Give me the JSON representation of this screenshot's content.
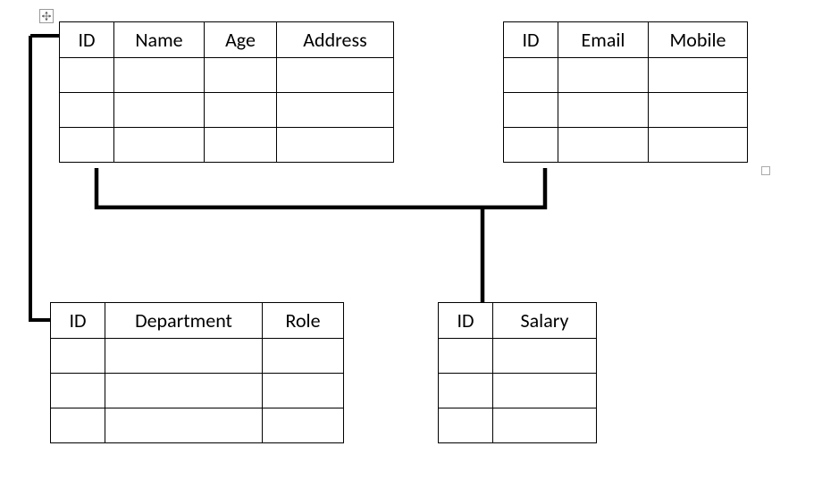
{
  "tables": {
    "person": {
      "columns": [
        "ID",
        "Name",
        "Age",
        "Address"
      ],
      "empty_rows": 3
    },
    "contact": {
      "columns": [
        "ID",
        "Email",
        "Mobile"
      ],
      "empty_rows": 3
    },
    "job": {
      "columns": [
        "ID",
        "Department",
        "Role"
      ],
      "empty_rows": 3
    },
    "pay": {
      "columns": [
        "ID",
        "Salary"
      ],
      "empty_rows": 3
    }
  }
}
